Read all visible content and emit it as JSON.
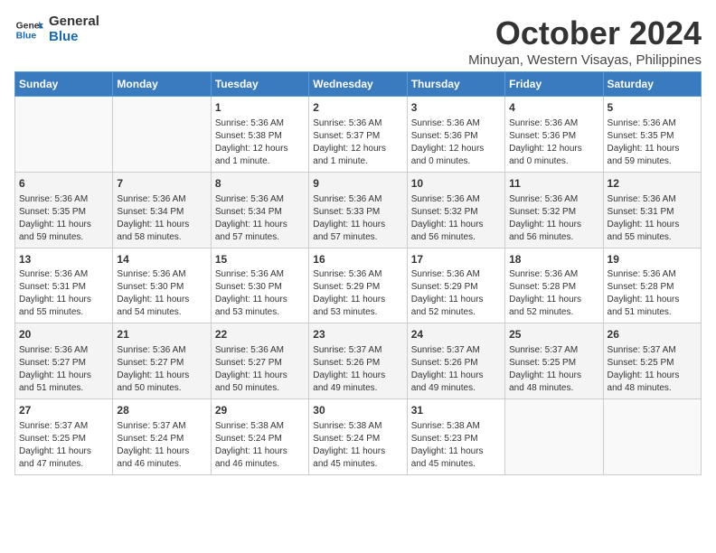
{
  "header": {
    "logo_line1": "General",
    "logo_line2": "Blue",
    "month": "October 2024",
    "location": "Minuyan, Western Visayas, Philippines"
  },
  "weekdays": [
    "Sunday",
    "Monday",
    "Tuesday",
    "Wednesday",
    "Thursday",
    "Friday",
    "Saturday"
  ],
  "weeks": [
    [
      {
        "day": "",
        "info": ""
      },
      {
        "day": "",
        "info": ""
      },
      {
        "day": "1",
        "info": "Sunrise: 5:36 AM\nSunset: 5:38 PM\nDaylight: 12 hours\nand 1 minute."
      },
      {
        "day": "2",
        "info": "Sunrise: 5:36 AM\nSunset: 5:37 PM\nDaylight: 12 hours\nand 1 minute."
      },
      {
        "day": "3",
        "info": "Sunrise: 5:36 AM\nSunset: 5:36 PM\nDaylight: 12 hours\nand 0 minutes."
      },
      {
        "day": "4",
        "info": "Sunrise: 5:36 AM\nSunset: 5:36 PM\nDaylight: 12 hours\nand 0 minutes."
      },
      {
        "day": "5",
        "info": "Sunrise: 5:36 AM\nSunset: 5:35 PM\nDaylight: 11 hours\nand 59 minutes."
      }
    ],
    [
      {
        "day": "6",
        "info": "Sunrise: 5:36 AM\nSunset: 5:35 PM\nDaylight: 11 hours\nand 59 minutes."
      },
      {
        "day": "7",
        "info": "Sunrise: 5:36 AM\nSunset: 5:34 PM\nDaylight: 11 hours\nand 58 minutes."
      },
      {
        "day": "8",
        "info": "Sunrise: 5:36 AM\nSunset: 5:34 PM\nDaylight: 11 hours\nand 57 minutes."
      },
      {
        "day": "9",
        "info": "Sunrise: 5:36 AM\nSunset: 5:33 PM\nDaylight: 11 hours\nand 57 minutes."
      },
      {
        "day": "10",
        "info": "Sunrise: 5:36 AM\nSunset: 5:32 PM\nDaylight: 11 hours\nand 56 minutes."
      },
      {
        "day": "11",
        "info": "Sunrise: 5:36 AM\nSunset: 5:32 PM\nDaylight: 11 hours\nand 56 minutes."
      },
      {
        "day": "12",
        "info": "Sunrise: 5:36 AM\nSunset: 5:31 PM\nDaylight: 11 hours\nand 55 minutes."
      }
    ],
    [
      {
        "day": "13",
        "info": "Sunrise: 5:36 AM\nSunset: 5:31 PM\nDaylight: 11 hours\nand 55 minutes."
      },
      {
        "day": "14",
        "info": "Sunrise: 5:36 AM\nSunset: 5:30 PM\nDaylight: 11 hours\nand 54 minutes."
      },
      {
        "day": "15",
        "info": "Sunrise: 5:36 AM\nSunset: 5:30 PM\nDaylight: 11 hours\nand 53 minutes."
      },
      {
        "day": "16",
        "info": "Sunrise: 5:36 AM\nSunset: 5:29 PM\nDaylight: 11 hours\nand 53 minutes."
      },
      {
        "day": "17",
        "info": "Sunrise: 5:36 AM\nSunset: 5:29 PM\nDaylight: 11 hours\nand 52 minutes."
      },
      {
        "day": "18",
        "info": "Sunrise: 5:36 AM\nSunset: 5:28 PM\nDaylight: 11 hours\nand 52 minutes."
      },
      {
        "day": "19",
        "info": "Sunrise: 5:36 AM\nSunset: 5:28 PM\nDaylight: 11 hours\nand 51 minutes."
      }
    ],
    [
      {
        "day": "20",
        "info": "Sunrise: 5:36 AM\nSunset: 5:27 PM\nDaylight: 11 hours\nand 51 minutes."
      },
      {
        "day": "21",
        "info": "Sunrise: 5:36 AM\nSunset: 5:27 PM\nDaylight: 11 hours\nand 50 minutes."
      },
      {
        "day": "22",
        "info": "Sunrise: 5:36 AM\nSunset: 5:27 PM\nDaylight: 11 hours\nand 50 minutes."
      },
      {
        "day": "23",
        "info": "Sunrise: 5:37 AM\nSunset: 5:26 PM\nDaylight: 11 hours\nand 49 minutes."
      },
      {
        "day": "24",
        "info": "Sunrise: 5:37 AM\nSunset: 5:26 PM\nDaylight: 11 hours\nand 49 minutes."
      },
      {
        "day": "25",
        "info": "Sunrise: 5:37 AM\nSunset: 5:25 PM\nDaylight: 11 hours\nand 48 minutes."
      },
      {
        "day": "26",
        "info": "Sunrise: 5:37 AM\nSunset: 5:25 PM\nDaylight: 11 hours\nand 48 minutes."
      }
    ],
    [
      {
        "day": "27",
        "info": "Sunrise: 5:37 AM\nSunset: 5:25 PM\nDaylight: 11 hours\nand 47 minutes."
      },
      {
        "day": "28",
        "info": "Sunrise: 5:37 AM\nSunset: 5:24 PM\nDaylight: 11 hours\nand 46 minutes."
      },
      {
        "day": "29",
        "info": "Sunrise: 5:38 AM\nSunset: 5:24 PM\nDaylight: 11 hours\nand 46 minutes."
      },
      {
        "day": "30",
        "info": "Sunrise: 5:38 AM\nSunset: 5:24 PM\nDaylight: 11 hours\nand 45 minutes."
      },
      {
        "day": "31",
        "info": "Sunrise: 5:38 AM\nSunset: 5:23 PM\nDaylight: 11 hours\nand 45 minutes."
      },
      {
        "day": "",
        "info": ""
      },
      {
        "day": "",
        "info": ""
      }
    ]
  ]
}
